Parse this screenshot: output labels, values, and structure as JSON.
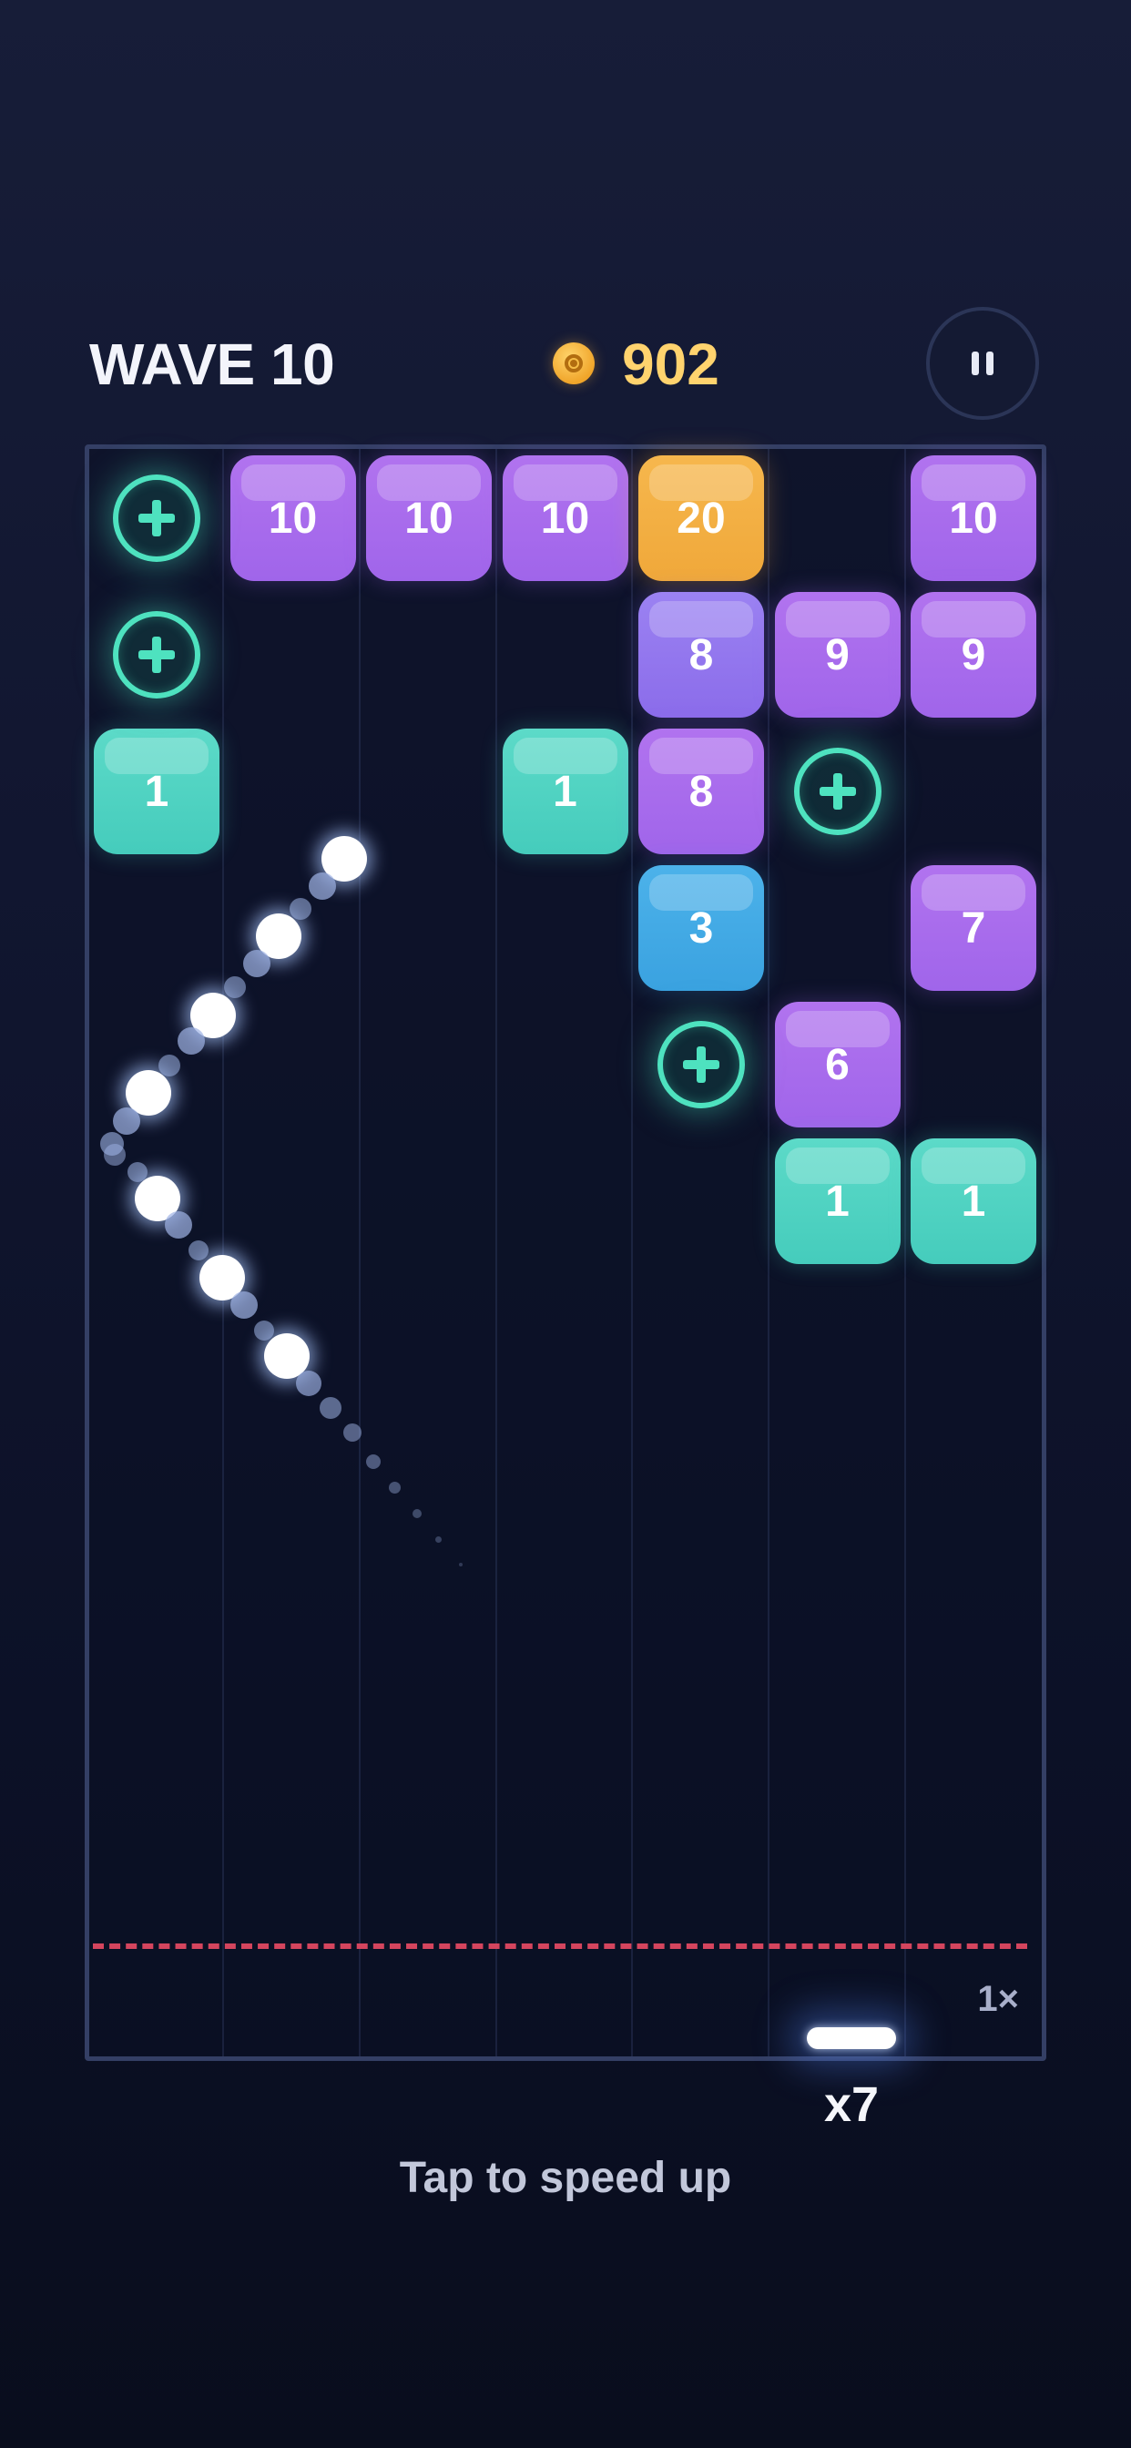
{
  "hud": {
    "wave_label": "WAVE 10",
    "coins": "902",
    "coin_icon": "coin-icon",
    "pause_icon": "pause-icon"
  },
  "board": {
    "speed": "1×",
    "blocks": [
      {
        "col": 1,
        "row": 0,
        "value": "10",
        "color": "purple"
      },
      {
        "col": 2,
        "row": 0,
        "value": "10",
        "color": "purple"
      },
      {
        "col": 3,
        "row": 0,
        "value": "10",
        "color": "purple"
      },
      {
        "col": 4,
        "row": 0,
        "value": "20",
        "color": "orange"
      },
      {
        "col": 6,
        "row": 0,
        "value": "10",
        "color": "purple"
      },
      {
        "col": 4,
        "row": 1,
        "value": "8",
        "color": "violet"
      },
      {
        "col": 5,
        "row": 1,
        "value": "9",
        "color": "purple"
      },
      {
        "col": 6,
        "row": 1,
        "value": "9",
        "color": "purple"
      },
      {
        "col": 0,
        "row": 2,
        "value": "1",
        "color": "teal"
      },
      {
        "col": 3,
        "row": 2,
        "value": "1",
        "color": "teal"
      },
      {
        "col": 4,
        "row": 2,
        "value": "8",
        "color": "purple"
      },
      {
        "col": 4,
        "row": 3,
        "value": "3",
        "color": "blue"
      },
      {
        "col": 6,
        "row": 3,
        "value": "7",
        "color": "purple"
      },
      {
        "col": 5,
        "row": 4,
        "value": "6",
        "color": "purple"
      },
      {
        "col": 5,
        "row": 5,
        "value": "1",
        "color": "teal"
      },
      {
        "col": 6,
        "row": 5,
        "value": "1",
        "color": "teal"
      }
    ],
    "powerups": [
      {
        "col": 0,
        "row": 0,
        "type": "plus-ball"
      },
      {
        "col": 0,
        "row": 1,
        "type": "plus-ball"
      },
      {
        "col": 5,
        "row": 2,
        "type": "plus-ball"
      },
      {
        "col": 4,
        "row": 4,
        "type": "plus-ball"
      }
    ]
  },
  "launcher": {
    "ball_count": "x7"
  },
  "hint": "Tap to speed up",
  "colors": {
    "purple": "#a86bec",
    "violet": "#9276ee",
    "orange": "#f3af43",
    "teal": "#4fd2c2",
    "blue": "#42aae5",
    "powerup": "#4ee2bf",
    "danger_line": "#d4455e",
    "coin": "#ffd36e"
  }
}
